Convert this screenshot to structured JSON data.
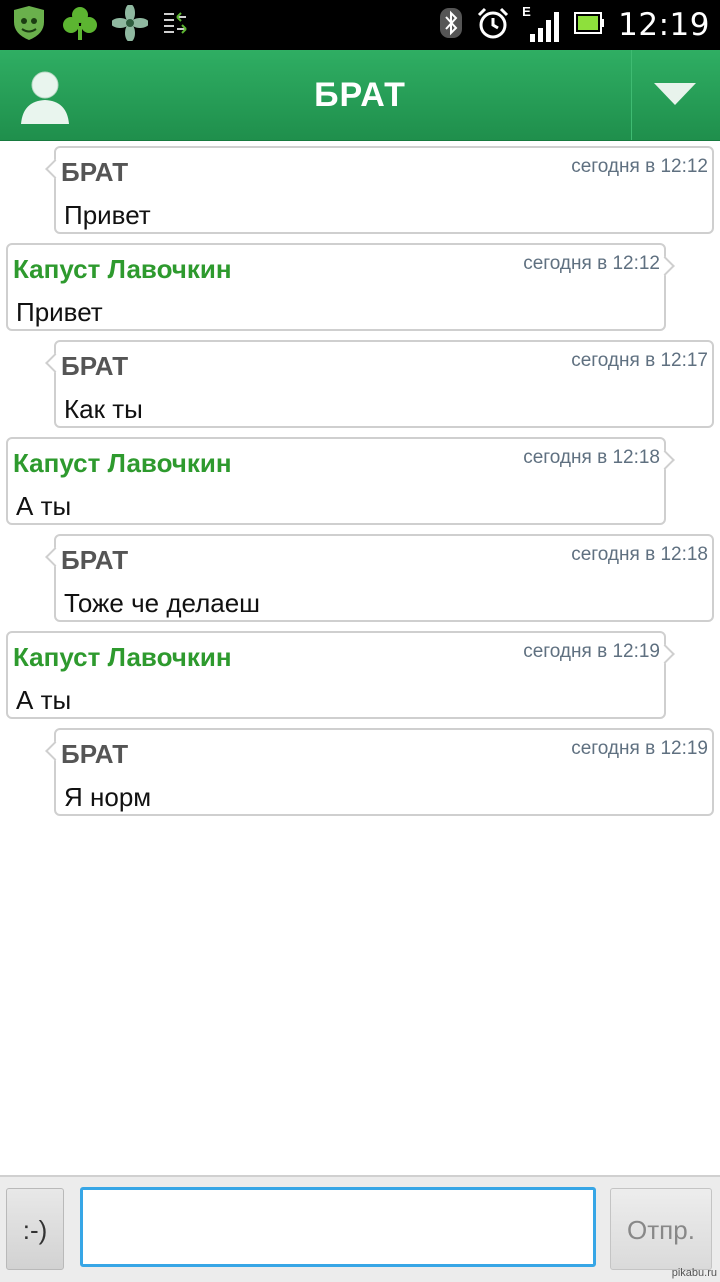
{
  "status_bar": {
    "time": "12:19",
    "network_type": "E",
    "icons": [
      "app-shield-icon",
      "clover-icon",
      "flower-icon",
      "sync-icon",
      "bluetooth-icon",
      "alarm-icon",
      "signal-icon",
      "battery-icon"
    ]
  },
  "header": {
    "title": "БРАТ",
    "avatar_icon": "user-avatar-icon",
    "menu_icon": "dropdown-triangle-icon"
  },
  "messages": [
    {
      "direction": "incoming",
      "sender": "БРАТ",
      "time": "сегодня в 12:12",
      "text": "Привет"
    },
    {
      "direction": "outgoing",
      "sender": "Капуст Лавочкин",
      "time": "сегодня в 12:12",
      "text": "Привет"
    },
    {
      "direction": "incoming",
      "sender": "БРАТ",
      "time": "сегодня в 12:17",
      "text": "Как ты"
    },
    {
      "direction": "outgoing",
      "sender": "Капуст Лавочкин",
      "time": "сегодня в 12:18",
      "text": "А ты"
    },
    {
      "direction": "incoming",
      "sender": "БРАТ",
      "time": "сегодня в 12:18",
      "text": "Тоже че делаеш"
    },
    {
      "direction": "outgoing",
      "sender": "Капуст Лавочкин",
      "time": "сегодня в 12:19",
      "text": "А ты"
    },
    {
      "direction": "incoming",
      "sender": "БРАТ",
      "time": "сегодня в 12:19",
      "text": "Я норм"
    }
  ],
  "composer": {
    "smiley_label": ":-)",
    "input_value": "",
    "send_label": "Отпр."
  },
  "watermark": "pikabu.ru",
  "colors": {
    "header_green": "#1f9a52",
    "own_name_green": "#2e9a2e",
    "input_focus_blue": "#37a6e6"
  }
}
